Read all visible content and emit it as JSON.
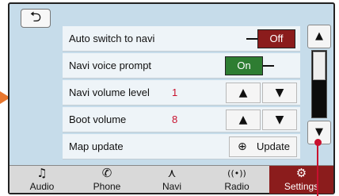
{
  "header": {
    "back_icon": "back-arrow-icon",
    "back_glyph": "⮌"
  },
  "settings": {
    "auto_switch": {
      "label": "Auto switch to navi",
      "state": "Off"
    },
    "voice_prompt": {
      "label": "Navi voice prompt",
      "state": "On"
    },
    "navi_volume": {
      "label": "Navi volume level",
      "value": "1"
    },
    "boot_volume": {
      "label": "Boot volume",
      "value": "8"
    },
    "map_update": {
      "label": "Map update",
      "button_label": "Update"
    }
  },
  "stepper": {
    "up_glyph": "▲",
    "down_glyph": "▼"
  },
  "scroll": {
    "up_glyph": "▲",
    "down_glyph": "▼",
    "position_fraction": 0.0
  },
  "nav": {
    "items": [
      {
        "label": "Audio",
        "icon": "music-note-icon",
        "glyph": "♫"
      },
      {
        "label": "Phone",
        "icon": "phone-icon",
        "glyph": "✆"
      },
      {
        "label": "Navi",
        "icon": "navigation-arrow-icon",
        "glyph": "⋏"
      },
      {
        "label": "Radio",
        "icon": "radio-signal-icon",
        "glyph": "((•))"
      },
      {
        "label": "Settings",
        "icon": "settings-gear-icon",
        "glyph": "⚙"
      }
    ],
    "active_index": 4
  },
  "colors": {
    "off_toggle": "#8b1c1c",
    "on_toggle": "#2e7d32",
    "value_text": "#c8102e",
    "screen_bg": "#c6dcea",
    "active_tab": "#8b1c1c"
  }
}
